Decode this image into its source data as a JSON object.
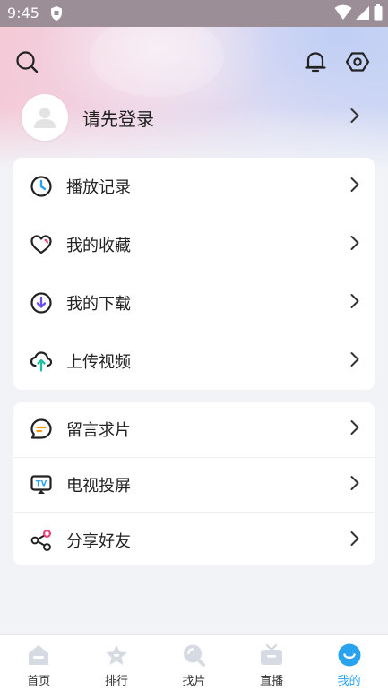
{
  "status_bar": {
    "time": "9:45"
  },
  "profile": {
    "login_prompt": "请先登录"
  },
  "menu_group_1": [
    {
      "label": "播放记录",
      "icon": "history-clock-icon"
    },
    {
      "label": "我的收藏",
      "icon": "heart-icon"
    },
    {
      "label": "我的下载",
      "icon": "download-icon"
    },
    {
      "label": "上传视频",
      "icon": "cloud-upload-icon"
    }
  ],
  "menu_group_2": [
    {
      "label": "留言求片",
      "icon": "message-icon"
    },
    {
      "label": "电视投屏",
      "icon": "tv-cast-icon"
    },
    {
      "label": "分享好友",
      "icon": "share-icon"
    }
  ],
  "tabbar": [
    {
      "label": "首页",
      "icon": "home-icon"
    },
    {
      "label": "排行",
      "icon": "star-rank-icon"
    },
    {
      "label": "找片",
      "icon": "search-film-icon"
    },
    {
      "label": "直播",
      "icon": "live-tv-icon"
    },
    {
      "label": "我的",
      "icon": "profile-face-icon",
      "active": true
    }
  ],
  "colors": {
    "accent": "#29a3f0",
    "inactive_tab": "#d6dae3"
  }
}
